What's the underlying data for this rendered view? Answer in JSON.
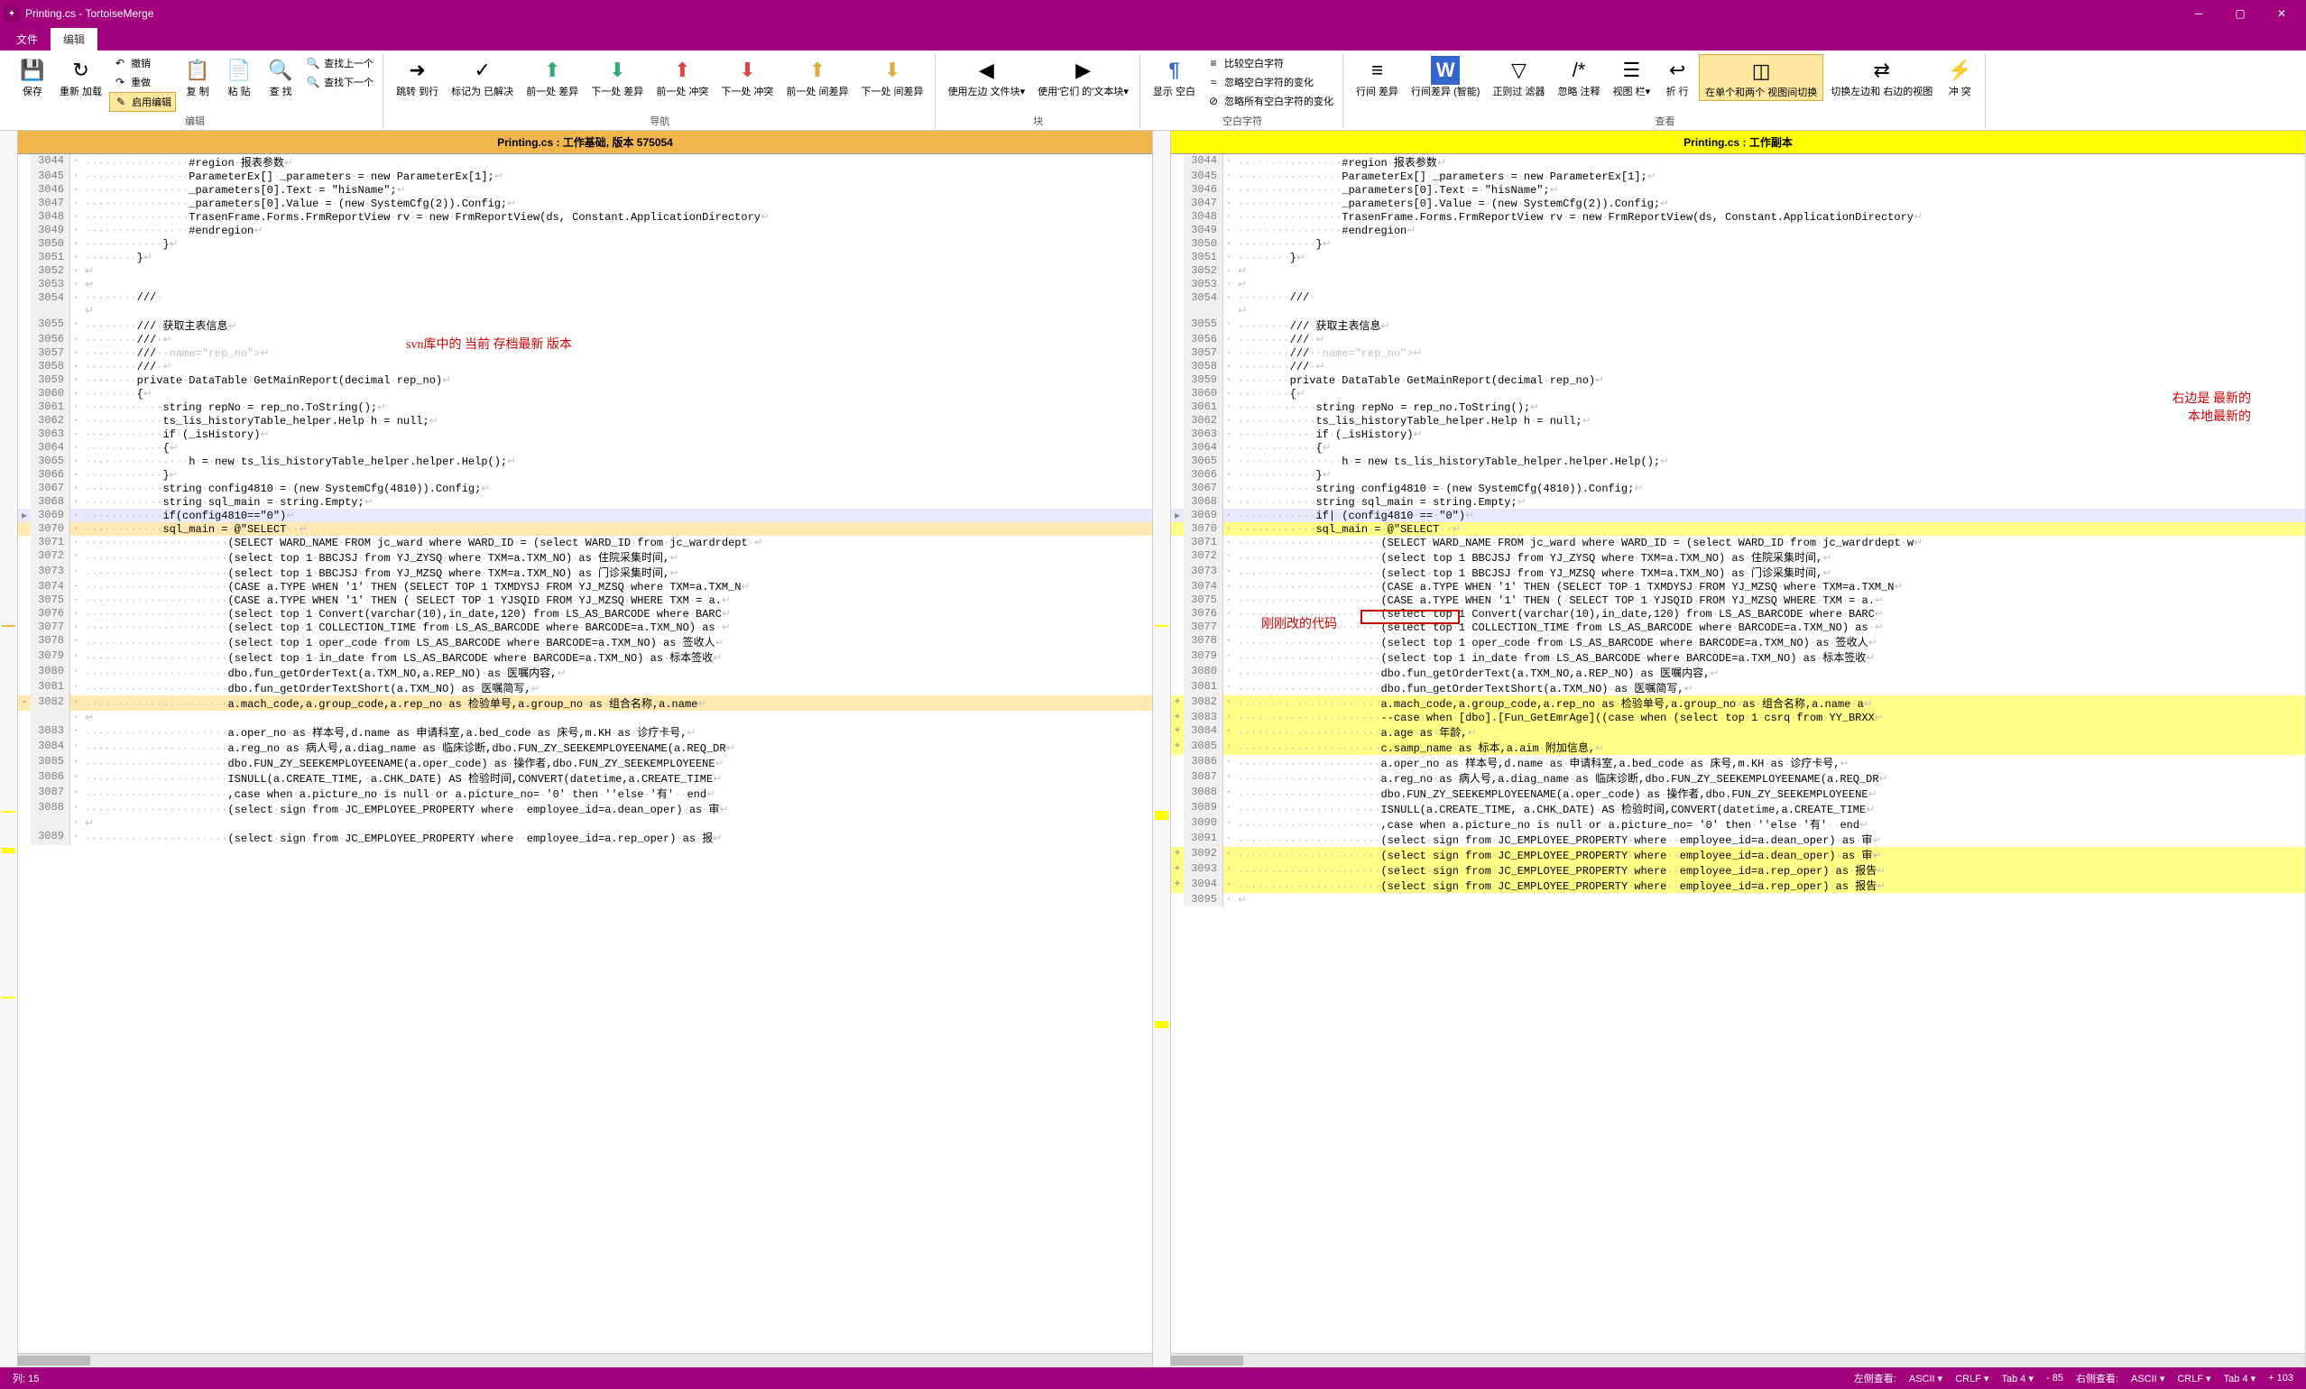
{
  "window": {
    "title": "Printing.cs - TortoiseMerge"
  },
  "tabs": {
    "file": "文件",
    "edit": "编辑"
  },
  "ribbon": {
    "save": "保存",
    "reload": "重新\n加载",
    "undo": "撤销",
    "redo": "重做",
    "enable_edit": "启用编辑",
    "copy": "复\n制",
    "paste": "粘\n贴",
    "find": "查\n找",
    "find_prev": "查找上一个",
    "find_next": "查找下一个",
    "goto": "跳转\n到行",
    "mark": "标记为\n已解决",
    "prev": "前一处\n差异",
    "next": "下一处\n差异",
    "prev_conf": "前一处\n冲突",
    "next_conf": "下一处\n冲突",
    "prev_inline": "前一处\n间差异",
    "next_inline": "下一处\n间差异",
    "use_left": "使用左边\n文件块▾",
    "use_right": "使用'它们\n的'文本块▾",
    "show_ws": "显示\n空白",
    "cmp_ws": "比较空白字符",
    "ign_ws_change": "忽略空白字符的变化",
    "ign_all_ws": "忽略所有空白字符的变化",
    "inline": "行间\n差异",
    "inline_smart": "行间差异\n(智能)",
    "regex_filter": "正则过\n滤器",
    "ign_comment": "忽略\n注释",
    "view_bar": "视图\n栏▾",
    "wrap": "折\n行",
    "switch_view": "在单个和两个\n视图间切换",
    "switch_side": "切换左边和\n右边的视图",
    "conflict": "冲\n突",
    "grp_edit": "编辑",
    "grp_nav": "导航",
    "grp_block": "块",
    "grp_ws": "空白字符",
    "grp_view": "查看"
  },
  "panes": {
    "left_title": "Printing.cs : 工作基础, 版本 575054",
    "right_title": "Printing.cs : 工作副本"
  },
  "annot": {
    "left": "svn库中的 当前 存档最新 版本",
    "right1": "右边是 最新的",
    "right2": "本地最新的",
    "changed": "刚刚改的代码"
  },
  "statusbar": {
    "col": "列: 15",
    "left_view": "左侧查看:",
    "ascii_l": "ASCII ▾",
    "crlf_l": "CRLF ▾",
    "tab_l": "Tab 4 ▾",
    "diff_l": "- 85",
    "right_view": "右侧查看:",
    "ascii_r": "ASCII ▾",
    "crlf_r": "CRLF ▾",
    "tab_r": "Tab 4 ▾",
    "diff_r": "+ 103"
  },
  "left_lines": [
    {
      "n": 3044,
      "c": "normal",
      "t": "················#region·报表参数"
    },
    {
      "n": 3045,
      "c": "normal",
      "t": "················ParameterEx[]·_parameters·=·new·ParameterEx[1];"
    },
    {
      "n": 3046,
      "c": "normal",
      "t": "················_parameters[0].Text·=·\"hisName\";"
    },
    {
      "n": 3047,
      "c": "normal",
      "t": "················_parameters[0].Value·=·(new·SystemCfg(2)).Config;"
    },
    {
      "n": 3048,
      "c": "normal",
      "t": "················TrasenFrame.Forms.FrmReportView·rv·=·new·FrmReportView(ds,·Constant.ApplicationDirectory"
    },
    {
      "n": 3049,
      "c": "normal",
      "t": "················#endregion"
    },
    {
      "n": 3050,
      "c": "normal",
      "t": "············}"
    },
    {
      "n": 3051,
      "c": "normal",
      "t": "········}"
    },
    {
      "n": 3052,
      "c": "normal",
      "t": ""
    },
    {
      "n": 3053,
      "c": "normal",
      "t": ""
    },
    {
      "n": 3054,
      "c": "normal",
      "t": "········///·<summary>"
    },
    {
      "n": 3055,
      "c": "normal",
      "t": "········///·获取主表信息"
    },
    {
      "n": 3056,
      "c": "normal",
      "t": "········///·</summary>"
    },
    {
      "n": 3057,
      "c": "normal",
      "t": "········///·<param·name=\"rep_no\"></param>"
    },
    {
      "n": 3058,
      "c": "normal",
      "t": "········///·<returns></returns>"
    },
    {
      "n": 3059,
      "c": "normal",
      "t": "········private·DataTable·GetMainReport(decimal·rep_no)"
    },
    {
      "n": 3060,
      "c": "normal",
      "t": "········{"
    },
    {
      "n": 3061,
      "c": "normal",
      "t": "············string·repNo·=·rep_no.ToString();"
    },
    {
      "n": 3062,
      "c": "normal",
      "t": "············ts_lis_historyTable_helper.Help·h·=·null;"
    },
    {
      "n": 3063,
      "c": "normal",
      "t": "············if·(_isHistory)"
    },
    {
      "n": 3064,
      "c": "normal",
      "t": "············{"
    },
    {
      "n": 3065,
      "c": "normal",
      "t": "················h·=·new·ts_lis_historyTable_helper.helper.Help();"
    },
    {
      "n": 3066,
      "c": "normal",
      "t": "············}"
    },
    {
      "n": 3067,
      "c": "normal",
      "t": "············string·config4810·=·(new·SystemCfg(4810)).Config;"
    },
    {
      "n": 3068,
      "c": "normal",
      "t": "············string·sql_main·=·string.Empty;"
    },
    {
      "n": 3069,
      "c": "ctx",
      "m": "▸",
      "t": "············if(config4810==\"0\")"
    },
    {
      "n": 3070,
      "c": "mod",
      "t": "············sql_main·=·@\"SELECT··"
    },
    {
      "n": 3071,
      "c": "normal",
      "t": "······················(SELECT·WARD_NAME·FROM·jc_ward·where·WARD_ID·=·(select·WARD_ID·from·jc_wardrdept·"
    },
    {
      "n": 3072,
      "c": "normal",
      "t": "······················(select·top·1·BBCJSJ·from·YJ_ZYSQ·where·TXM=a.TXM_NO)·as·住院采集时间,"
    },
    {
      "n": 3073,
      "c": "normal",
      "t": "······················(select·top·1·BBCJSJ·from·YJ_MZSQ·where·TXM=a.TXM_NO)·as·门诊采集时间,"
    },
    {
      "n": 3074,
      "c": "normal",
      "t": "······················(CASE·a.TYPE·WHEN·'1'·THEN·(SELECT·TOP·1·TXMDYSJ·FROM·YJ_MZSQ·where·TXM=a.TXM_N"
    },
    {
      "n": 3075,
      "c": "normal",
      "t": "······················(CASE·a.TYPE·WHEN·'1'·THEN·(·SELECT·TOP·1·YJSQID·FROM·YJ_MZSQ·WHERE·TXM·=·a."
    },
    {
      "n": 3076,
      "c": "normal",
      "t": "······················(select·top·1·Convert(varchar(10),in_date,120)·from·LS_AS_BARCODE·where·BARC"
    },
    {
      "n": 3077,
      "c": "normal",
      "t": "······················(select·top·1·COLLECTION_TIME·from·LS_AS_BARCODE·where·BARCODE=a.TXM_NO)·as·"
    },
    {
      "n": 3078,
      "c": "normal",
      "t": "······················(select·top·1·oper_code·from·LS_AS_BARCODE·where·BARCODE=a.TXM_NO)·as·签收人"
    },
    {
      "n": 3079,
      "c": "normal",
      "t": "······················(select·top·1·in_date·from·LS_AS_BARCODE·where·BARCODE=a.TXM_NO)·as·标本签收"
    },
    {
      "n": 3080,
      "c": "normal",
      "t": "······················dbo.fun_getOrderText(a.TXM_NO,a.REP_NO)·as·医嘱内容,"
    },
    {
      "n": 3081,
      "c": "normal",
      "t": "······················dbo.fun_getOrderTextShort(a.TXM_NO)·as·医嘱简写,"
    },
    {
      "n": 3082,
      "c": "mod",
      "m": "-",
      "t": "······················a.mach_code,a.group_code,a.rep_no·as·检验单号,a.group_no·as·组合名称,a.name"
    },
    {
      "n": "",
      "c": "normal",
      "t": ""
    },
    {
      "n": 3083,
      "c": "normal",
      "t": "······················a.oper_no·as·样本号,d.name·as·申请科室,a.bed_code·as·床号,m.KH·as·诊疗卡号,"
    },
    {
      "n": 3084,
      "c": "normal",
      "t": "······················a.reg_no·as·病人号,a.diag_name·as·临床诊断,dbo.FUN_ZY_SEEKEMPLOYEENAME(a.REQ_DR"
    },
    {
      "n": 3085,
      "c": "normal",
      "t": "······················dbo.FUN_ZY_SEEKEMPLOYEENAME(a.oper_code)·as·操作者,dbo.FUN_ZY_SEEKEMPLOYEENE"
    },
    {
      "n": 3086,
      "c": "normal",
      "t": "······················ISNULL(a.CREATE_TIME,·a.CHK_DATE)·AS·检验时间,CONVERT(datetime,a.CREATE_TIME"
    },
    {
      "n": 3087,
      "c": "normal",
      "t": "······················,case·when·a.picture_no·is·null·or·a.picture_no=·'0'·then·''else·'有'··end"
    },
    {
      "n": 3088,
      "c": "normal",
      "t": "······················(select·sign·from·JC_EMPLOYEE_PROPERTY·where··employee_id=a.dean_oper)·as·审"
    },
    {
      "n": "",
      "c": "normal",
      "t": ""
    },
    {
      "n": 3089,
      "c": "normal",
      "t": "······················(select·sign·from·JC_EMPLOYEE_PROPERTY·where··employee_id=a.rep_oper)·as·报"
    }
  ],
  "right_lines": [
    {
      "n": 3044,
      "c": "normal",
      "t": "················#region·报表参数"
    },
    {
      "n": 3045,
      "c": "normal",
      "t": "················ParameterEx[]·_parameters·=·new·ParameterEx[1];"
    },
    {
      "n": 3046,
      "c": "normal",
      "t": "················_parameters[0].Text·=·\"hisName\";"
    },
    {
      "n": 3047,
      "c": "normal",
      "t": "················_parameters[0].Value·=·(new·SystemCfg(2)).Config;"
    },
    {
      "n": 3048,
      "c": "normal",
      "t": "················TrasenFrame.Forms.FrmReportView·rv·=·new·FrmReportView(ds,·Constant.ApplicationDirectory"
    },
    {
      "n": 3049,
      "c": "normal",
      "t": "················#endregion"
    },
    {
      "n": 3050,
      "c": "normal",
      "t": "············}"
    },
    {
      "n": 3051,
      "c": "normal",
      "t": "········}"
    },
    {
      "n": 3052,
      "c": "normal",
      "t": ""
    },
    {
      "n": 3053,
      "c": "normal",
      "t": ""
    },
    {
      "n": 3054,
      "c": "normal",
      "t": "········///·<summary>"
    },
    {
      "n": 3055,
      "c": "normal",
      "t": "········///·获取主表信息"
    },
    {
      "n": 3056,
      "c": "normal",
      "t": "········///·</summary>"
    },
    {
      "n": 3057,
      "c": "normal",
      "t": "········///·<param·name=\"rep_no\"></param>"
    },
    {
      "n": 3058,
      "c": "normal",
      "t": "········///·<returns></returns>"
    },
    {
      "n": 3059,
      "c": "normal",
      "t": "········private·DataTable·GetMainReport(decimal·rep_no)"
    },
    {
      "n": 3060,
      "c": "normal",
      "t": "········{"
    },
    {
      "n": 3061,
      "c": "normal",
      "t": "············string·repNo·=·rep_no.ToString();"
    },
    {
      "n": 3062,
      "c": "normal",
      "t": "············ts_lis_historyTable_helper.Help·h·=·null;"
    },
    {
      "n": 3063,
      "c": "normal",
      "t": "············if·(_isHistory)"
    },
    {
      "n": 3064,
      "c": "normal",
      "t": "············{"
    },
    {
      "n": 3065,
      "c": "normal",
      "t": "················h·=·new·ts_lis_historyTable_helper.helper.Help();"
    },
    {
      "n": 3066,
      "c": "normal",
      "t": "············}"
    },
    {
      "n": 3067,
      "c": "normal",
      "t": "············string·config4810·=·(new·SystemCfg(4810)).Config;"
    },
    {
      "n": 3068,
      "c": "normal",
      "t": "············string·sql_main·=·string.Empty;"
    },
    {
      "n": 3069,
      "c": "ctx",
      "m": "▸",
      "t": "············if|·(config4810·==·\"0\")"
    },
    {
      "n": 3070,
      "c": "add",
      "t": "············sql_main·=·@\"SELECT··"
    },
    {
      "n": 3071,
      "c": "normal",
      "t": "······················(SELECT·WARD_NAME·FROM·jc_ward·where·WARD_ID·=·(select·WARD_ID·from·jc_wardrdept·w"
    },
    {
      "n": 3072,
      "c": "normal",
      "t": "······················(select·top·1·BBCJSJ·from·YJ_ZYSQ·where·TXM=a.TXM_NO)·as·住院采集时间,"
    },
    {
      "n": 3073,
      "c": "normal",
      "t": "······················(select·top·1·BBCJSJ·from·YJ_MZSQ·where·TXM=a.TXM_NO)·as·门诊采集时间,"
    },
    {
      "n": 3074,
      "c": "normal",
      "t": "······················(CASE·a.TYPE·WHEN·'1'·THEN·(SELECT·TOP·1·TXMDYSJ·FROM·YJ_MZSQ·where·TXM=a.TXM_N"
    },
    {
      "n": 3075,
      "c": "normal",
      "t": "······················(CASE·a.TYPE·WHEN·'1'·THEN·(·SELECT·TOP·1·YJSQID·FROM·YJ_MZSQ·WHERE·TXM·=·a."
    },
    {
      "n": 3076,
      "c": "normal",
      "t": "······················(select·top·1·Convert(varchar(10),in_date,120)·from·LS_AS_BARCODE·where·BARC"
    },
    {
      "n": 3077,
      "c": "normal",
      "t": "······················(select·top·1·COLLECTION_TIME·from·LS_AS_BARCODE·where·BARCODE=a.TXM_NO)·as·"
    },
    {
      "n": 3078,
      "c": "normal",
      "t": "······················(select·top·1·oper_code·from·LS_AS_BARCODE·where·BARCODE=a.TXM_NO)·as·签收人"
    },
    {
      "n": 3079,
      "c": "normal",
      "t": "······················(select·top·1·in_date·from·LS_AS_BARCODE·where·BARCODE=a.TXM_NO)·as·标本签收"
    },
    {
      "n": 3080,
      "c": "normal",
      "t": "······················dbo.fun_getOrderText(a.TXM_NO,a.REP_NO)·as·医嘱内容,"
    },
    {
      "n": 3081,
      "c": "normal",
      "t": "······················dbo.fun_getOrderTextShort(a.TXM_NO)·as·医嘱简写,"
    },
    {
      "n": 3082,
      "c": "add",
      "m": "+",
      "t": "······················a.mach_code,a.group_code,a.rep_no·as·检验单号,a.group_no·as·组合名称,a.name·a"
    },
    {
      "n": 3083,
      "c": "add",
      "m": "+",
      "t": "······················--case·when·[dbo].[Fun_GetEmrAge]((case·when·(select·top·1·csrq·from·YY_BRXX"
    },
    {
      "n": 3084,
      "c": "add",
      "m": "+",
      "t": "······················a.age·as·年龄,"
    },
    {
      "n": 3085,
      "c": "add",
      "m": "+",
      "t": "······················c.samp_name·as·标本,a.aim·附加信息,"
    },
    {
      "n": 3086,
      "c": "normal",
      "t": "······················a.oper_no·as·样本号,d.name·as·申请科室,a.bed_code·as·床号,m.KH·as·诊疗卡号,"
    },
    {
      "n": 3087,
      "c": "normal",
      "t": "······················a.reg_no·as·病人号,a.diag_name·as·临床诊断,dbo.FUN_ZY_SEEKEMPLOYEENAME(a.REQ_DR"
    },
    {
      "n": 3088,
      "c": "normal",
      "t": "······················dbo.FUN_ZY_SEEKEMPLOYEENAME(a.oper_code)·as·操作者,dbo.FUN_ZY_SEEKEMPLOYEENE"
    },
    {
      "n": 3089,
      "c": "normal",
      "t": "······················ISNULL(a.CREATE_TIME,·a.CHK_DATE)·AS·检验时间,CONVERT(datetime,a.CREATE_TIME"
    },
    {
      "n": 3090,
      "c": "normal",
      "t": "······················,case·when·a.picture_no·is·null·or·a.picture_no=·'0'·then·''else·'有'··end"
    },
    {
      "n": 3091,
      "c": "normal",
      "t": "······················(select·sign·from·JC_EMPLOYEE_PROPERTY·where··employee_id=a.dean_oper)·as·审"
    },
    {
      "n": 3092,
      "c": "add",
      "m": "+",
      "t": "······················(select·sign·from·JC_EMPLOYEE_PROPERTY·where··employee_id=a.dean_oper)·as·审"
    },
    {
      "n": 3093,
      "c": "add",
      "m": "+",
      "t": "······················(select·sign·from·JC_EMPLOYEE_PROPERTY·where··employee_id=a.rep_oper)·as·报告"
    },
    {
      "n": 3094,
      "c": "add",
      "m": "+",
      "t": "······················(select·sign·from·JC_EMPLOYEE_PROPERTY·where··employee_id=a.rep_oper)·as·报告"
    },
    {
      "n": 3095,
      "c": "normal",
      "t": ""
    }
  ]
}
